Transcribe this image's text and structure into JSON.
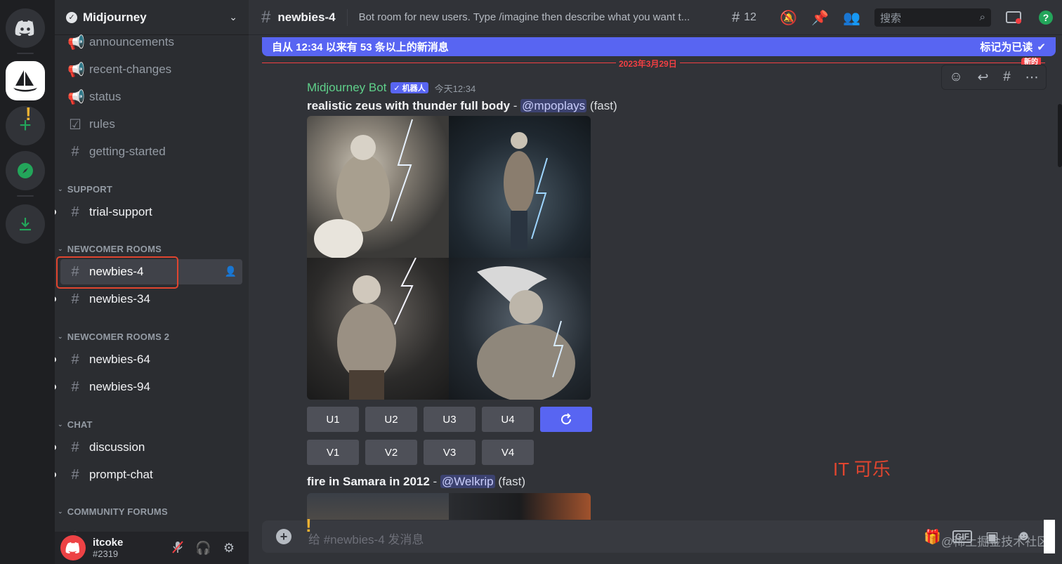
{
  "app": {
    "server_name": "Midjourney",
    "channel_title": "newbies-4",
    "channel_topic": "Bot room for new users. Type /imagine then describe what you want t...",
    "thread_count": "12",
    "search_placeholder": "搜索"
  },
  "sidebar": {
    "channels_top": [
      {
        "label": "announcements",
        "icon": "megaphone-icon"
      },
      {
        "label": "recent-changes",
        "icon": "megaphone-icon"
      },
      {
        "label": "status",
        "icon": "megaphone-icon"
      },
      {
        "label": "rules",
        "icon": "checkbox-icon"
      },
      {
        "label": "getting-started",
        "icon": "hash-icon"
      }
    ],
    "categories": {
      "support": "SUPPORT",
      "newcomer": "NEWCOMER ROOMS",
      "newcomer2": "NEWCOMER ROOMS 2",
      "chat": "CHAT",
      "forums": "COMMUNITY FORUMS"
    },
    "support_channels": [
      {
        "label": "trial-support"
      }
    ],
    "newcomer_channels": [
      {
        "label": "newbies-4"
      },
      {
        "label": "newbies-34"
      }
    ],
    "newcomer2_channels": [
      {
        "label": "newbies-64"
      },
      {
        "label": "newbies-94"
      }
    ],
    "chat_channels": [
      {
        "label": "discussion"
      },
      {
        "label": "prompt-chat"
      }
    ],
    "partial_forum": "...."
  },
  "user": {
    "name": "itcoke",
    "tag": "#2319"
  },
  "banner": {
    "text": "自从 12:34 以来有 53 条以上的新消息",
    "mark_read": "标记为已读"
  },
  "date_divider": {
    "label": "2023年3月29日",
    "new_tag": "新的"
  },
  "message": {
    "author": "Midjourney Bot",
    "bot_tag": "✓ 机器人",
    "timestamp": "今天12:34",
    "prompt1_bold": "realistic zeus with thunder full body",
    "prompt1_dash": " - ",
    "prompt1_mention": "@mpoplays",
    "prompt1_speed": "(fast)",
    "upscale_buttons": [
      "U1",
      "U2",
      "U3",
      "U4"
    ],
    "variation_buttons": [
      "V1",
      "V2",
      "V3",
      "V4"
    ],
    "reroll_icon": "refresh-icon",
    "prompt2_bold": "fire in Samara in 2012",
    "prompt2_dash": " - ",
    "prompt2_mention": "@Welkrip",
    "prompt2_speed": "(fast)"
  },
  "composer": {
    "placeholder": "给 #newbies-4 发消息",
    "watermark": "@稀土掘金技术社区"
  },
  "overlay": {
    "watermark_text": "IT 可乐"
  },
  "colors": {
    "accent": "#5865f2",
    "bot_name": "#5fd08a",
    "new_marker": "#f23f43",
    "highlight_box": "#e0452f"
  }
}
